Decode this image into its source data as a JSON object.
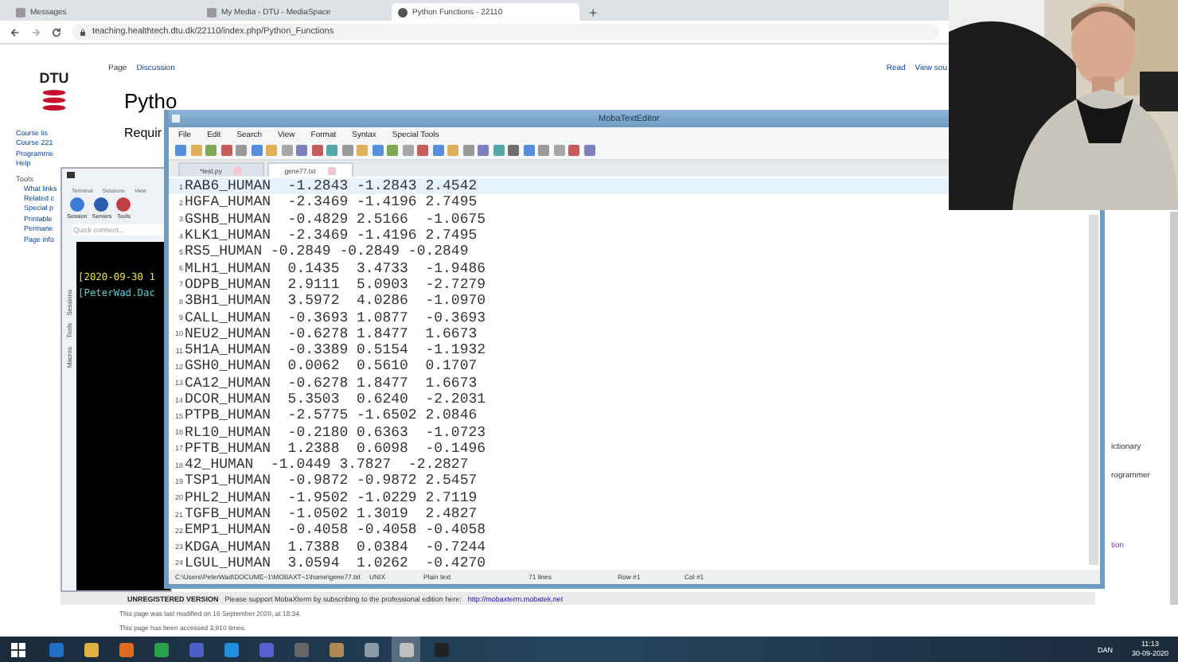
{
  "browser": {
    "tabs": [
      {
        "title": "Messages",
        "selected": false
      },
      {
        "title": "My Media - DTU - MediaSpace",
        "selected": false
      },
      {
        "title": "Python Functions - 22110",
        "selected": true
      }
    ],
    "new_tab": "+",
    "address": "teaching.healthtech.dtu.dk/22110/index.php/Python_Functions"
  },
  "wiki": {
    "logo": "DTU",
    "page_tabs": [
      "Page",
      "Discussion"
    ],
    "view_tabs": [
      "Read",
      "View sou"
    ],
    "title": "Pytho",
    "heading": "Requir",
    "nav_links": [
      "Course lis",
      "Course 221",
      "Programme",
      "Help"
    ],
    "tools_heading": "Tools",
    "tool_links": [
      "What links",
      "Related c",
      "Special p",
      "Printable",
      "Permane",
      "Page info"
    ],
    "right_links": [
      "ictionary",
      "rogrammer",
      "tion"
    ],
    "notice_label": "UNREGISTERED VERSION",
    "notice_text": "Please support MobaXterm by subscribing to the professional edition here:",
    "notice_link": "http://mobaxterm.mobatek.net",
    "footer": [
      "This page was last modified on 16 September 2020, at 18:34.",
      "This page has been accessed 3,910 times."
    ]
  },
  "mobaxterm": {
    "tabs": [
      "Terminal",
      "Sessions",
      "View"
    ],
    "buttons": [
      "Session",
      "Servers",
      "Tools"
    ],
    "quick_connect": "Quick connect...",
    "side_tabs": [
      "Sessions",
      "Tools",
      "Macros"
    ],
    "terminal_lines": [
      {
        "text": "[2020-09-30 1",
        "color": "#e8e04a"
      },
      {
        "text": "[PeterWad.Dac",
        "color": "#4ad0d8"
      }
    ]
  },
  "editor": {
    "title": "MobaTextEditor",
    "menu": [
      "File",
      "Edit",
      "Search",
      "View",
      "Format",
      "Syntax",
      "Special Tools"
    ],
    "tabs": [
      {
        "label": "*test.py",
        "selected": false
      },
      {
        "label": "gene77.txt",
        "selected": true
      }
    ],
    "lines": [
      {
        "number": "1",
        "text": "RAB6_HUMAN  -1.2843 -1.2843 2.4542",
        "current": true
      },
      {
        "number": "2",
        "text": "HGFA_HUMAN  -2.3469 -1.4196 2.7495",
        "current": false
      },
      {
        "number": "3",
        "text": "GSHB_HUMAN  -0.4829 2.5166  -1.0675",
        "current": false
      },
      {
        "number": "4",
        "text": "KLK1_HUMAN  -2.3469 -1.4196 2.7495",
        "current": false
      },
      {
        "number": "5",
        "text": "RS5_HUMAN -0.2849 -0.2849 -0.2849",
        "current": false
      },
      {
        "number": "6",
        "text": "MLH1_HUMAN  0.1435  3.4733  -1.9486",
        "current": false
      },
      {
        "number": "7",
        "text": "ODPB_HUMAN  2.9111  5.0903  -2.7279",
        "current": false
      },
      {
        "number": "8",
        "text": "3BH1_HUMAN  3.5972  4.0286  -1.0970",
        "current": false
      },
      {
        "number": "9",
        "text": "CALL_HUMAN  -0.3693 1.0877  -0.3693",
        "current": false
      },
      {
        "number": "10",
        "text": "NEU2_HUMAN  -0.6278 1.8477  1.6673",
        "current": false
      },
      {
        "number": "11",
        "text": "5H1A_HUMAN  -0.3389 0.5154  -1.1932",
        "current": false
      },
      {
        "number": "12",
        "text": "GSH0_HUMAN  0.0062  0.5610  0.1707",
        "current": false
      },
      {
        "number": "13",
        "text": "CA12_HUMAN  -0.6278 1.8477  1.6673",
        "current": false
      },
      {
        "number": "14",
        "text": "DCOR_HUMAN  5.3503  0.6240  -2.2031",
        "current": false
      },
      {
        "number": "15",
        "text": "PTPB_HUMAN  -2.5775 -1.6502 2.0846",
        "current": false
      },
      {
        "number": "16",
        "text": "RL10_HUMAN  -0.2180 0.6363  -1.0723",
        "current": false
      },
      {
        "number": "17",
        "text": "PFTB_HUMAN  1.2388  0.6098  -0.1496",
        "current": false
      },
      {
        "number": "18",
        "text": "42_HUMAN  -1.0449 3.7827  -2.2827",
        "current": false
      },
      {
        "number": "19",
        "text": "TSP1_HUMAN  -0.9872 -0.9872 2.5457",
        "current": false
      },
      {
        "number": "20",
        "text": "PHL2_HUMAN  -1.9502 -1.0229 2.7119",
        "current": false
      },
      {
        "number": "21",
        "text": "TGFB_HUMAN  -1.0502 1.3019  2.4827",
        "current": false
      },
      {
        "number": "22",
        "text": "EMP1_HUMAN  -0.4058 -0.4058 -0.4058",
        "current": false
      },
      {
        "number": "23",
        "text": "KDGA_HUMAN  1.7388  0.0384  -0.7244",
        "current": false
      },
      {
        "number": "24",
        "text": "LGUL_HUMAN  3.0594  1.0262  -0.4270",
        "current": false
      }
    ],
    "status": [
      "C:\\Users\\PeterWad\\DOCUME~1\\MOBAXT~1\\home\\gene77.txt",
      "UNIX",
      "Plain text",
      "71 lines",
      "Row #1",
      "Col #1"
    ]
  },
  "taskbar": {
    "language": "DAN",
    "time": "11:13",
    "date": "30-09-2020"
  }
}
